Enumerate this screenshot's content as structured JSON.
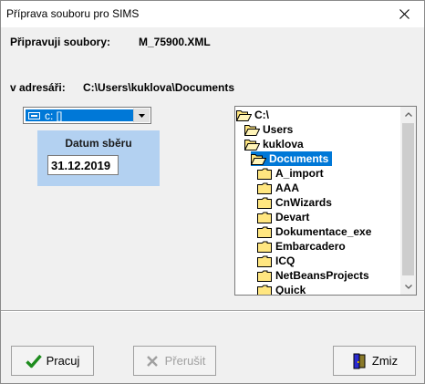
{
  "window": {
    "title": "Příprava souboru pro SIMS"
  },
  "info": {
    "files_label": "Připravuji soubory:",
    "files_value": "M_75900.XML",
    "dir_label": "v adresáři:",
    "dir_value": "C:\\Users\\kuklova\\Documents"
  },
  "drive_select": {
    "value": "c: []"
  },
  "datum": {
    "label": "Datum sběru",
    "value": "31.12.2019"
  },
  "tree": {
    "selected": "Documents",
    "items": [
      {
        "label": "C:\\",
        "open": true
      },
      {
        "label": "Users",
        "open": true
      },
      {
        "label": "kuklova",
        "open": true
      },
      {
        "label": "Documents",
        "open": true
      },
      {
        "label": "A_import",
        "open": false
      },
      {
        "label": "AAA",
        "open": false
      },
      {
        "label": "CnWizards",
        "open": false
      },
      {
        "label": "Devart",
        "open": false
      },
      {
        "label": "Dokumentace_exe",
        "open": false
      },
      {
        "label": "Embarcadero",
        "open": false
      },
      {
        "label": "ICQ",
        "open": false
      },
      {
        "label": "NetBeansProjects",
        "open": false
      },
      {
        "label": "Quick",
        "open": false
      }
    ]
  },
  "buttons": {
    "ok": {
      "label": "Pracuj",
      "icon": "check-icon",
      "color": "#1e8c1e"
    },
    "abort": {
      "label": "Přerušit",
      "icon": "x-icon",
      "enabled": false
    },
    "cancel": {
      "label": "Zmiz",
      "icon": "door-exit-icon"
    }
  },
  "colors": {
    "selection": "#0078d7",
    "datum_panel": "#b3d1f1",
    "folder": "#ffe680"
  }
}
